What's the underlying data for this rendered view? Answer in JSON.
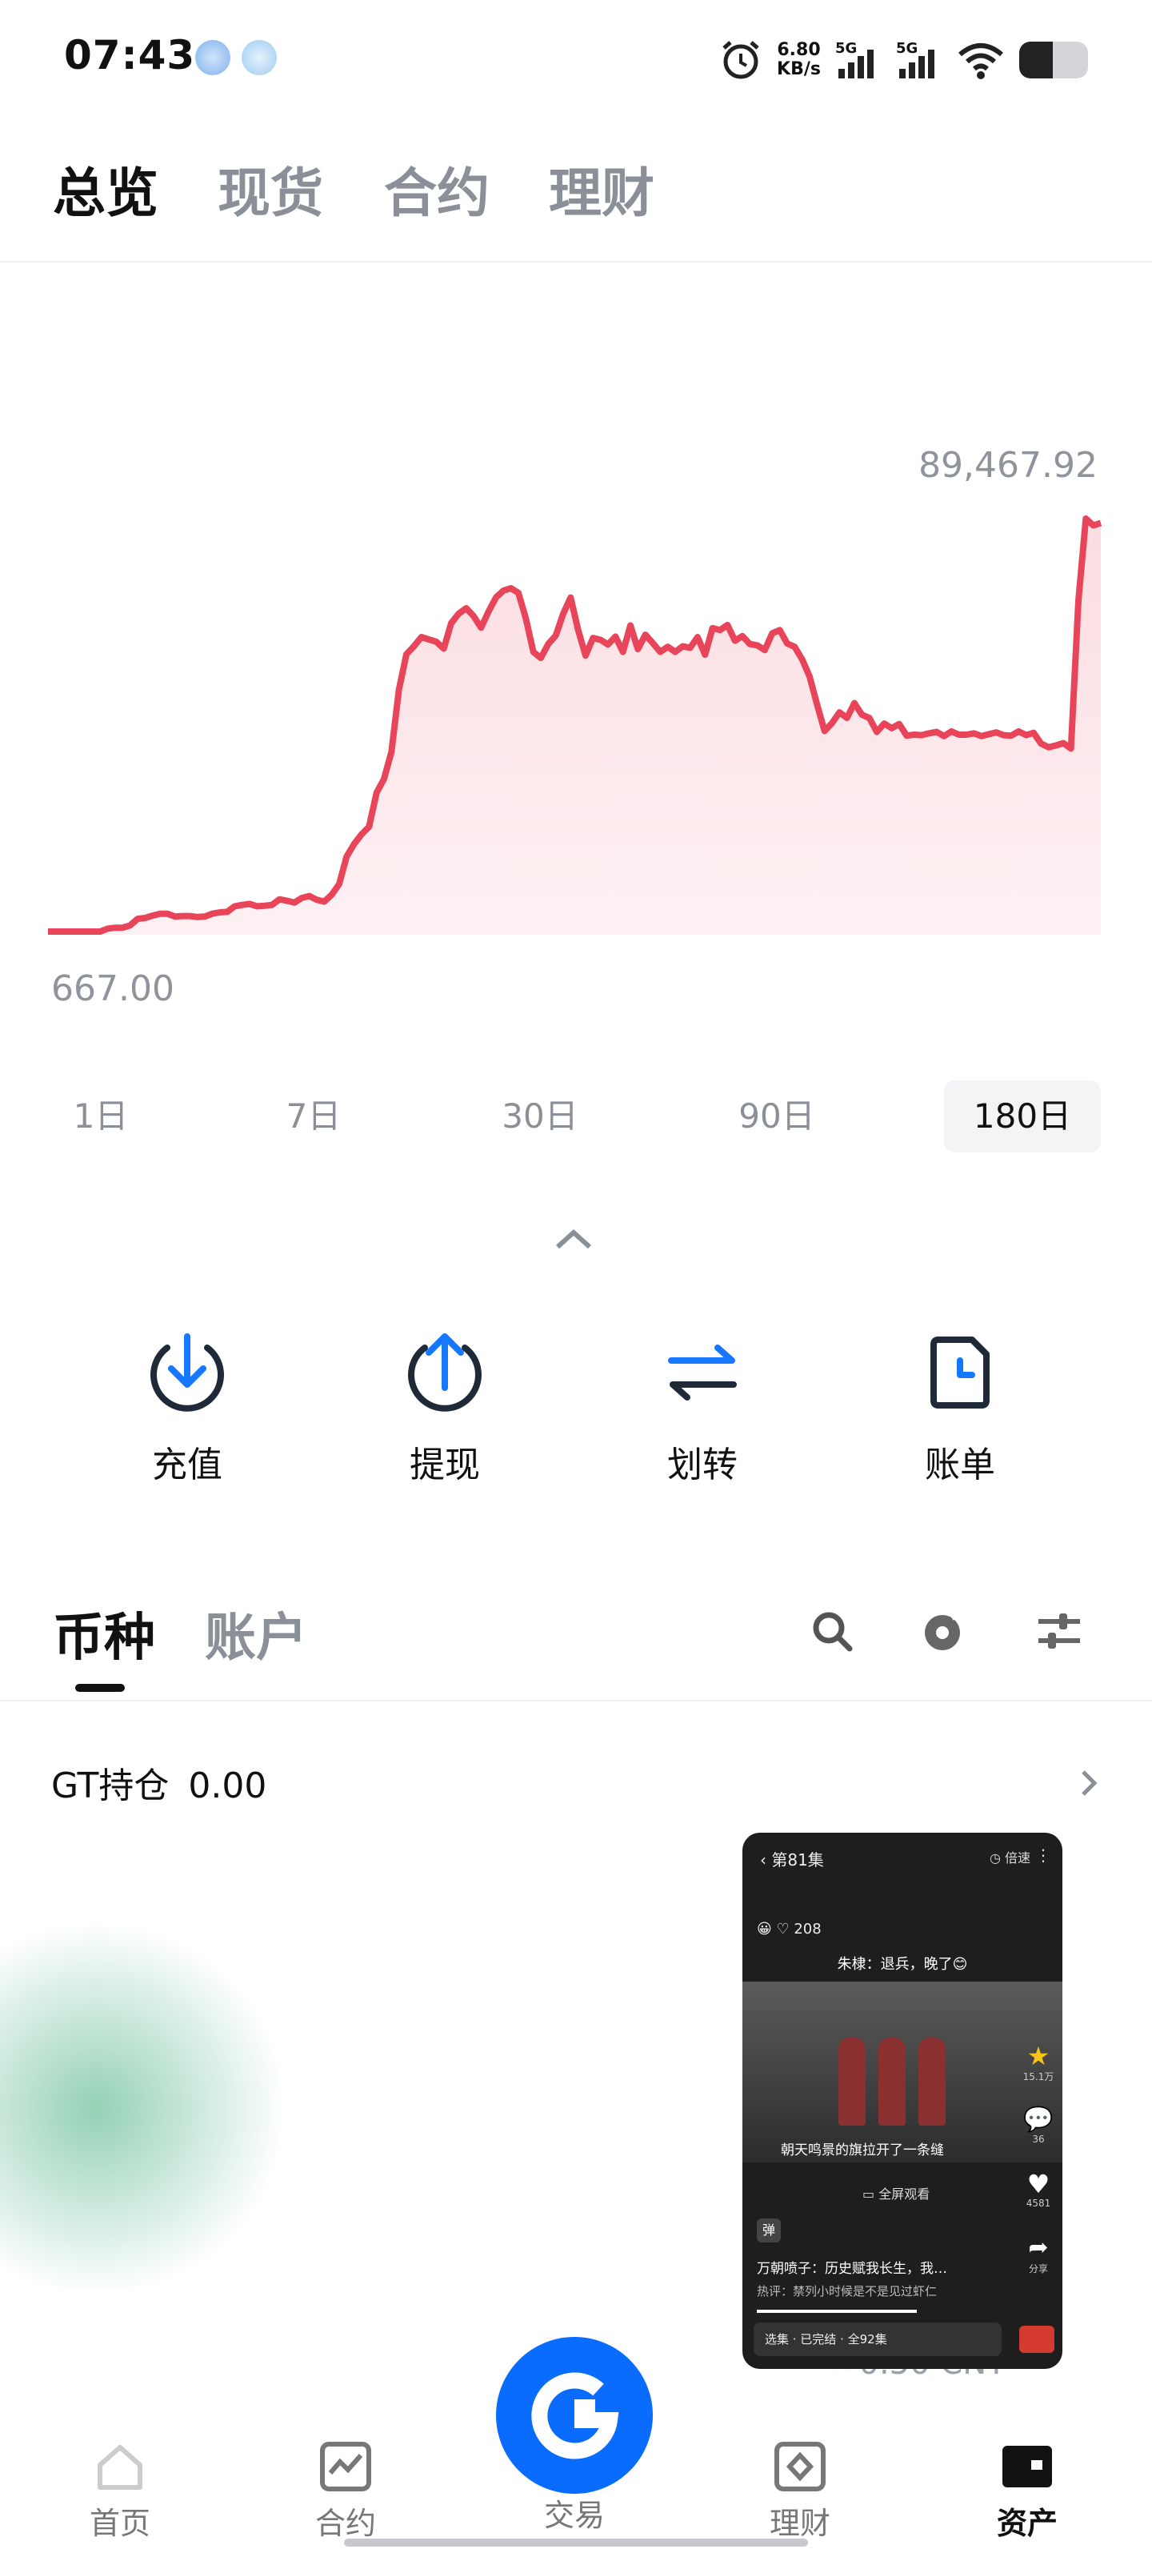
{
  "status_bar": {
    "time": "07:43",
    "net_speed_value": "6.80",
    "net_speed_unit": "KB/s",
    "signal_1": "5G",
    "signal_2": "5G",
    "icons": [
      "alarm-icon",
      "signal-icon",
      "wifi-icon",
      "battery-icon"
    ]
  },
  "top_tabs": [
    "总览",
    "现货",
    "合约",
    "理财"
  ],
  "active_top_tab": 0,
  "chart_data": {
    "type": "area",
    "max_label": "89,467.92",
    "min_label": "667.00",
    "color": "#e8455a",
    "fill_color": "#fbdde1",
    "range": "180日",
    "values": [
      667,
      667,
      667,
      667,
      667,
      667,
      667,
      667,
      1300,
      1500,
      1500,
      2000,
      3400,
      3600,
      4100,
      4500,
      4500,
      3900,
      4000,
      4000,
      3800,
      3900,
      4500,
      4800,
      4900,
      6100,
      6400,
      6600,
      6100,
      6200,
      6400,
      7600,
      7300,
      6900,
      7900,
      8300,
      7500,
      7100,
      8600,
      10900,
      16800,
      19500,
      21600,
      23200,
      30500,
      33500,
      39300,
      52700,
      60300,
      62000,
      64000,
      63500,
      63000,
      61500,
      67000,
      69000,
      70200,
      68500,
      66000,
      69500,
      72500,
      74000,
      74500,
      73500,
      68000,
      60800,
      59500,
      62500,
      64300,
      69000,
      72500,
      65500,
      60000,
      63800,
      63400,
      62400,
      64100,
      60800,
      66500,
      61400,
      64500,
      62700,
      60800,
      61900,
      60800,
      62000,
      61700,
      64000,
      60200,
      65900,
      65500,
      66600,
      63200,
      64200,
      62500,
      62200,
      61200,
      64800,
      65500,
      62600,
      61900,
      59200,
      55500,
      49500,
      43800,
      45500,
      47800,
      46600,
      49800,
      47300,
      46600,
      43600,
      45400,
      44400,
      45300,
      42800,
      43000,
      42900,
      43300,
      43600,
      42700,
      43700,
      43000,
      43000,
      43300,
      42700,
      43100,
      43500,
      42900,
      42800,
      43700,
      42900,
      43400,
      41100,
      40300,
      40700,
      41200,
      40000,
      71800,
      89467.92,
      88000,
      88500
    ]
  },
  "range_tabs": [
    "1日",
    "7日",
    "30日",
    "90日",
    "180日"
  ],
  "active_range": 4,
  "actions": [
    {
      "label": "充值",
      "icon": "deposit-icon"
    },
    {
      "label": "提现",
      "icon": "withdraw-icon"
    },
    {
      "label": "划转",
      "icon": "transfer-icon"
    },
    {
      "label": "账单",
      "icon": "bill-icon"
    }
  ],
  "section_tabs": [
    "币种",
    "账户"
  ],
  "active_section_tab": 0,
  "toolbar_icons": [
    "search-icon",
    "hide-small-icon",
    "filter-icon"
  ],
  "gt_holding": {
    "label": "GT持仓",
    "value": "0.00"
  },
  "asset_row_partial": "≈0.50 CNY",
  "floating_video": {
    "episode": "第81集",
    "speed": "倍速",
    "likes_count": "208",
    "subtitle": "朱棣：退兵，晚了😊",
    "caption": "朝天鸣景的旗拉开了一条缝",
    "fullscreen": "全屏观看",
    "danmaku": "弹",
    "title": "万朝喷子：历史赋我长生，我…",
    "hot_comment": "热评：禁列小时候是不是见过虾仁",
    "series": "选集 · 已完结 · 全92集",
    "side": [
      {
        "icon": "star-icon",
        "count": "15.1万"
      },
      {
        "icon": "comment-icon",
        "count": "36"
      },
      {
        "icon": "heart-icon",
        "count": "4581"
      },
      {
        "icon": "share-icon",
        "count": "分享"
      }
    ]
  },
  "bottom_nav": [
    "首页",
    "合约",
    "交易",
    "理财",
    "资产"
  ],
  "active_bottom_nav": 4
}
